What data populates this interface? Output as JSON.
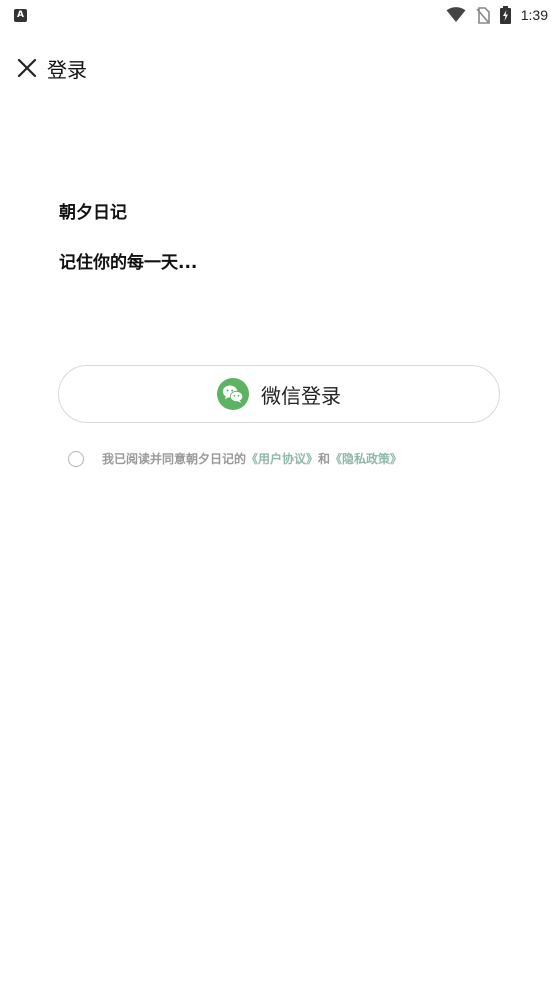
{
  "status_bar": {
    "app_badge": "A",
    "time": "1:39",
    "icons": [
      "wifi-icon",
      "no-sim-icon",
      "battery-charging-icon"
    ]
  },
  "header": {
    "close_icon": "close-icon",
    "title": "登录"
  },
  "intro": {
    "app_name": "朝夕日记",
    "slogan": "记住你的每一天..."
  },
  "wechat_login": {
    "icon": "wechat-icon",
    "label": "微信登录",
    "icon_color": "#5cb361"
  },
  "agreement": {
    "prefix": "我已阅读并同意朝夕日记的",
    "user_agreement": "《用户协议》",
    "conjunction": "和",
    "privacy_policy": "《隐私政策》",
    "checked": false,
    "link_color": "#8fb9a8"
  }
}
